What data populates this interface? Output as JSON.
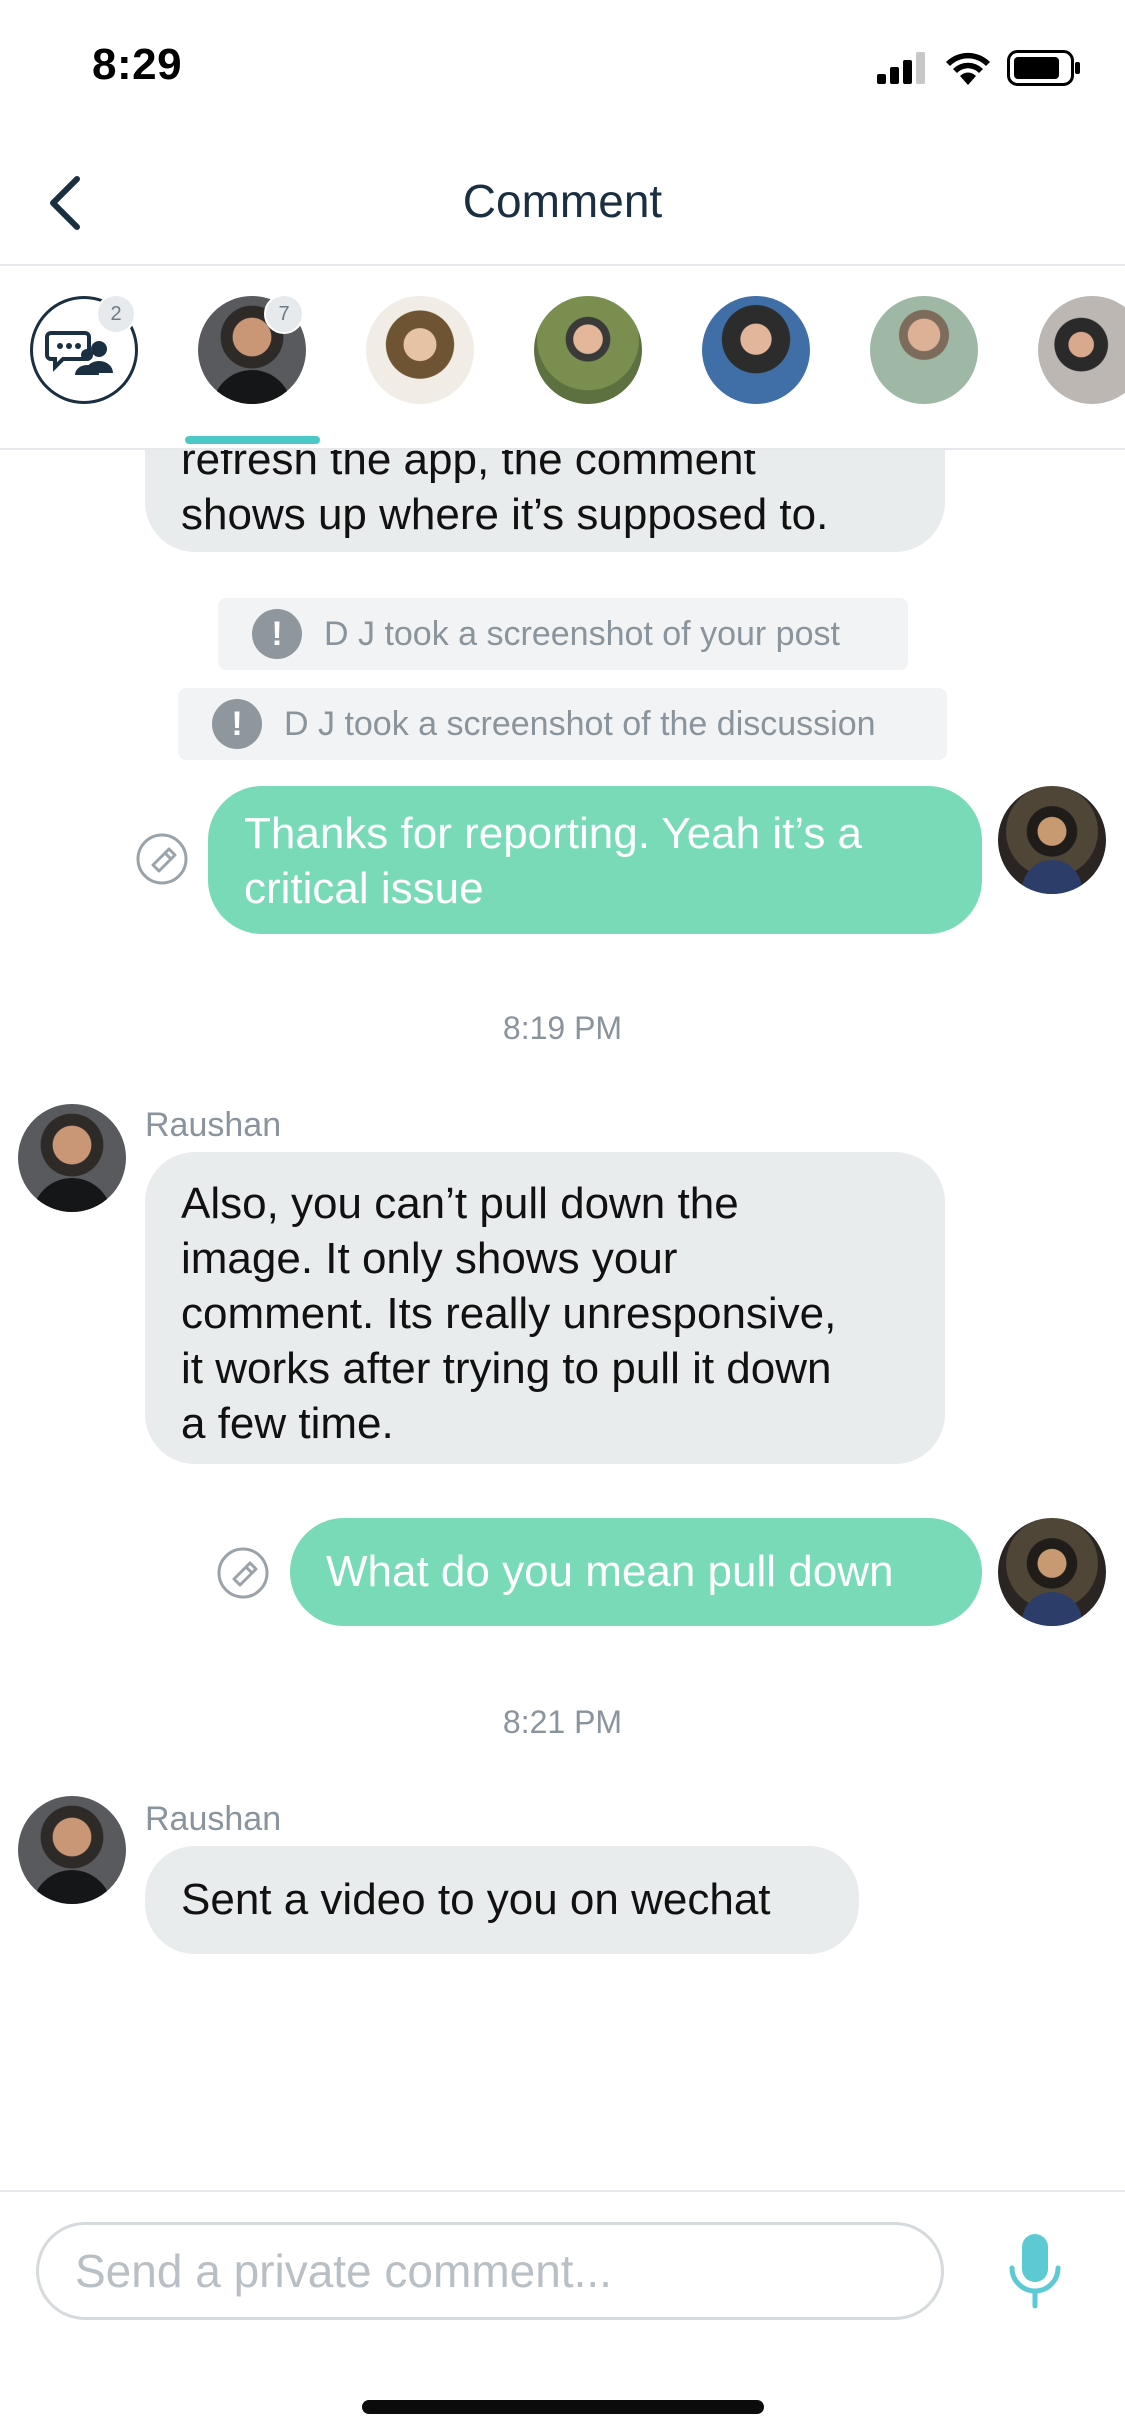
{
  "status_bar": {
    "time": "8:29"
  },
  "header": {
    "title": "Comment",
    "back_icon": "chevron-left-icon"
  },
  "participants": {
    "group_chat_icon": "group-chat-icon",
    "group_badge": "2",
    "selected_badge": "7",
    "underline_color": "#4cc9c7"
  },
  "messages": {
    "partial_message_lines": [
      "refresh the app, the comment",
      "shows up where it’s supposed to."
    ],
    "notices": [
      "D J took a screenshot of your post",
      "D J took a screenshot of the discussion"
    ],
    "outgoing_1": [
      "Thanks for reporting.  Yeah it’s a",
      "critical issue"
    ],
    "timestamp_1": "8:19 PM",
    "sender_1": "Raushan",
    "incoming_1": [
      "Also, you can’t pull down the",
      "image. It only shows your",
      "comment. Its really unresponsive,",
      "it works after trying to pull it down",
      "a few time."
    ],
    "outgoing_2": "What do you mean pull down",
    "timestamp_2": "8:21 PM",
    "sender_2": "Raushan",
    "incoming_2": "Sent a video to you on wechat"
  },
  "composer": {
    "placeholder": "Send a private comment...",
    "mic_icon": "microphone-icon"
  },
  "colors": {
    "outgoing_bubble": "#78dab7",
    "incoming_bubble": "#e8eced",
    "accent": "#4cc9c7",
    "title": "#1b2f42"
  }
}
